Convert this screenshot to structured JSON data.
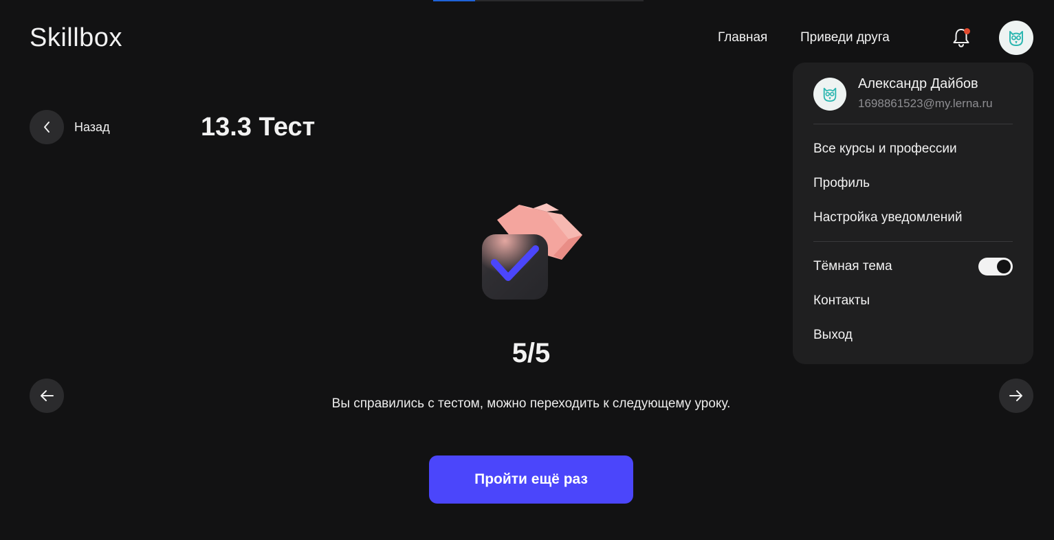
{
  "header": {
    "logo": "Skillbox",
    "nav": [
      {
        "label": "Главная"
      },
      {
        "label": "Приведи друга"
      }
    ],
    "has_notification": true
  },
  "top_progress": {
    "fraction": 0.2
  },
  "lesson": {
    "back_label": "Назад",
    "title": "13.3 Тест",
    "score": "5/5",
    "message": "Вы справились с тестом, можно переходить к следующему уроку.",
    "retry_label": "Пройти ещё раз"
  },
  "user_menu": {
    "name": "Александр Дайбов",
    "email": "1698861523@my.lerna.ru",
    "items_top": [
      {
        "label": "Все курсы и профессии"
      },
      {
        "label": "Профиль"
      },
      {
        "label": "Настройка уведомлений"
      }
    ],
    "dark_theme_label": "Тёмная тема",
    "dark_theme_enabled": true,
    "items_bottom": [
      {
        "label": "Контакты"
      },
      {
        "label": "Выход"
      }
    ]
  },
  "colors": {
    "background": "#121213",
    "accent": "#4b46fb",
    "panel": "#1f1f20",
    "notification_dot": "#e24a2e"
  }
}
